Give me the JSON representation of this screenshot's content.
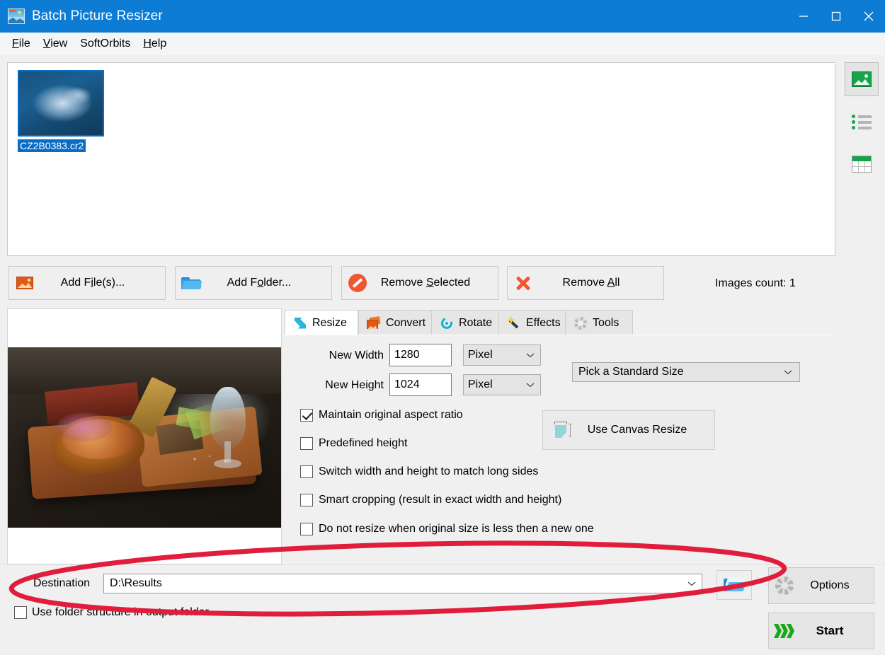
{
  "window": {
    "title": "Batch Picture Resizer",
    "app_icon": "picture-icon",
    "minimize": "minimize-icon",
    "maximize": "maximize-icon",
    "close": "close-icon"
  },
  "menu": {
    "items": [
      {
        "pre": "",
        "mnemonic": "F",
        "post": "ile"
      },
      {
        "pre": "",
        "mnemonic": "V",
        "post": "iew"
      },
      {
        "pre": "SoftOrbits",
        "mnemonic": "",
        "post": ""
      },
      {
        "pre": "",
        "mnemonic": "H",
        "post": "elp"
      }
    ]
  },
  "filelist": {
    "items": [
      {
        "filename": "CZ2B0383.cr2",
        "selected": true
      }
    ]
  },
  "viewmodes": [
    {
      "name": "thumbnail-view",
      "icon": "photo-icon",
      "selected": true
    },
    {
      "name": "list-view",
      "icon": "list-icon",
      "selected": false
    },
    {
      "name": "details-view",
      "icon": "grid-icon",
      "selected": false
    }
  ],
  "toolbar": {
    "add_files": {
      "pre": "Add F",
      "mnemonic": "i",
      "post": "le(s)...",
      "icon": "photo-icon"
    },
    "add_folder": {
      "pre": "Add F",
      "mnemonic": "o",
      "post": "lder...",
      "icon": "folder-icon"
    },
    "remove_selected": {
      "pre": "Remove ",
      "mnemonic": "S",
      "post": "elected",
      "icon": "deny-icon"
    },
    "remove_all": {
      "pre": "Remove ",
      "mnemonic": "A",
      "post": "ll",
      "icon": "cross-icon"
    },
    "images_count": "Images count: 1"
  },
  "tabs": [
    {
      "label": "Resize",
      "icon": "resize-arrows-icon",
      "active": true
    },
    {
      "label": "Convert",
      "icon": "convert-icon",
      "active": false
    },
    {
      "label": "Rotate",
      "icon": "rotate-icon",
      "active": false
    },
    {
      "label": "Effects",
      "icon": "magic-wand-icon",
      "active": false
    },
    {
      "label": "Tools",
      "icon": "gear-icon",
      "active": false
    }
  ],
  "resize_panel": {
    "new_width": {
      "label": "New Width",
      "value": "1280",
      "unit": "Pixel"
    },
    "new_height": {
      "label": "New Height",
      "value": "1024",
      "unit": "Pixel"
    },
    "standard_size": {
      "value": "Pick a Standard Size"
    },
    "canvas_button": {
      "label": "Use Canvas Resize",
      "icon": "canvas-resize-icon"
    },
    "checkboxes": [
      {
        "label": "Maintain original aspect ratio",
        "checked": true
      },
      {
        "label": "Predefined height",
        "checked": false
      },
      {
        "label": "Switch width and height to match long sides",
        "checked": false
      },
      {
        "label": "Smart cropping (result in exact width and height)",
        "checked": false
      },
      {
        "label": "Do not resize when original size is less then a new one",
        "checked": false
      }
    ]
  },
  "destination": {
    "label": "Destination",
    "value": "D:\\Results",
    "browse_icon": "open-folder-icon",
    "use_folder_structure": {
      "label": "Use folder structure in output folder",
      "checked": false
    }
  },
  "actions": {
    "options": {
      "label": "Options",
      "icon": "gear-icon"
    },
    "start": {
      "label": "Start",
      "icon": "green-arrows-icon"
    }
  },
  "annotation": {
    "shape": "red-ellipse-highlight",
    "color": "#e11d3c"
  },
  "colors": {
    "titlebar": "#0c7cd5",
    "window_bg": "#f0f0f0",
    "selection": "#0a6cc4",
    "accent_red": "#e11d3c",
    "start_green": "#18a81a"
  }
}
